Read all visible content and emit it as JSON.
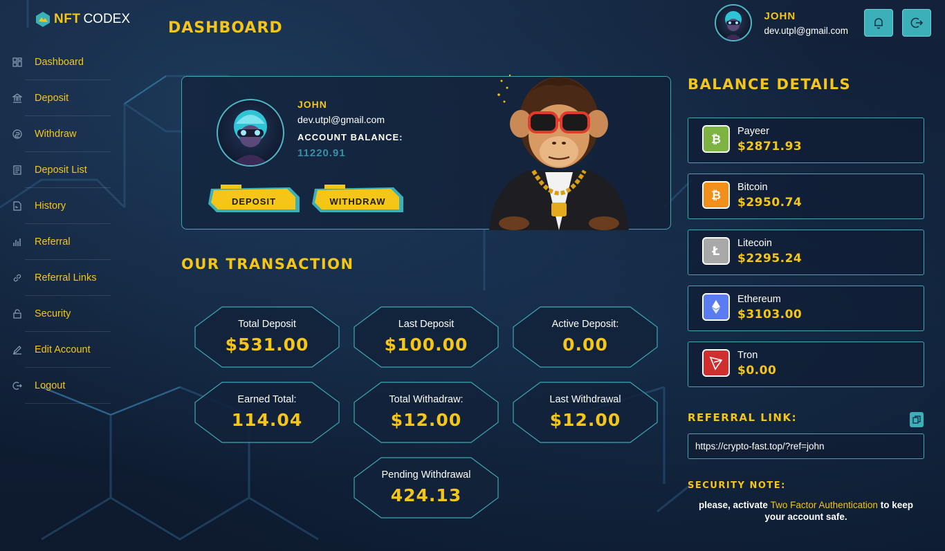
{
  "brand": {
    "nft": "NFT",
    "codex": "CODEX"
  },
  "page": {
    "title": "DASHBOARD"
  },
  "sidebar": {
    "items": [
      {
        "label": "Dashboard",
        "icon": "grid-icon"
      },
      {
        "label": "Deposit",
        "icon": "bank-icon"
      },
      {
        "label": "Withdraw",
        "icon": "coin-icon"
      },
      {
        "label": "Deposit List",
        "icon": "document-icon"
      },
      {
        "label": "History",
        "icon": "history-icon"
      },
      {
        "label": "Referral",
        "icon": "bar-chart-icon"
      },
      {
        "label": "Referral Links",
        "icon": "link-icon"
      },
      {
        "label": "Security",
        "icon": "lock-icon"
      },
      {
        "label": "Edit Account",
        "icon": "pencil-icon"
      },
      {
        "label": "Logout",
        "icon": "logout-icon"
      }
    ]
  },
  "user": {
    "name": "JOHN",
    "email": "dev.utpl@gmail.com"
  },
  "profile": {
    "name": "JOHN",
    "email": "dev.utpl@gmail.com",
    "balance_label": "ACCOUNT BALANCE:",
    "balance_value": "11220.91",
    "deposit_label": "DEPOSIT",
    "withdraw_label": "WITHDRAW"
  },
  "transactions": {
    "title": "OUR TRANSACTION",
    "cards": [
      {
        "label": "Total Deposit",
        "value": "$531.00"
      },
      {
        "label": "Last Deposit",
        "value": "$100.00"
      },
      {
        "label": "Active Deposit:",
        "value": "0.00"
      },
      {
        "label": "Earned Total:",
        "value": "114.04"
      },
      {
        "label": "Total Withadraw:",
        "value": "$12.00"
      },
      {
        "label": "Last Withdrawal",
        "value": "$12.00"
      },
      {
        "label": "Pending Withdrawal",
        "value": "424.13"
      }
    ]
  },
  "balance": {
    "title": "BALANCE DETAILS",
    "coins": [
      {
        "name": "Payeer",
        "amount": "$2871.93",
        "icon": "bitcoin-icon",
        "color": "#7cb342"
      },
      {
        "name": "Bitcoin",
        "amount": "$2950.74",
        "icon": "bitcoin-icon",
        "color": "#f0901a"
      },
      {
        "name": "Litecoin",
        "amount": "$2295.24",
        "icon": "litecoin-icon",
        "color": "#a8a8a8"
      },
      {
        "name": "Ethereum",
        "amount": "$3103.00",
        "icon": "ethereum-icon",
        "color": "#5b7cf0"
      },
      {
        "name": "Tron",
        "amount": "$0.00",
        "icon": "tron-icon",
        "color": "#d02f2f"
      }
    ]
  },
  "referral": {
    "title": "REFERRAL LINK:",
    "url": "https://crypto-fast.top/?ref=john"
  },
  "security": {
    "title": "SECURITY NOTE:",
    "prefix": "please, activate ",
    "link": "Two Factor Authentication",
    "suffix": " to keep your account safe."
  },
  "colors": {
    "accent": "#f5c518",
    "teal": "#3cb0b8",
    "background": "#0f1a2b"
  }
}
